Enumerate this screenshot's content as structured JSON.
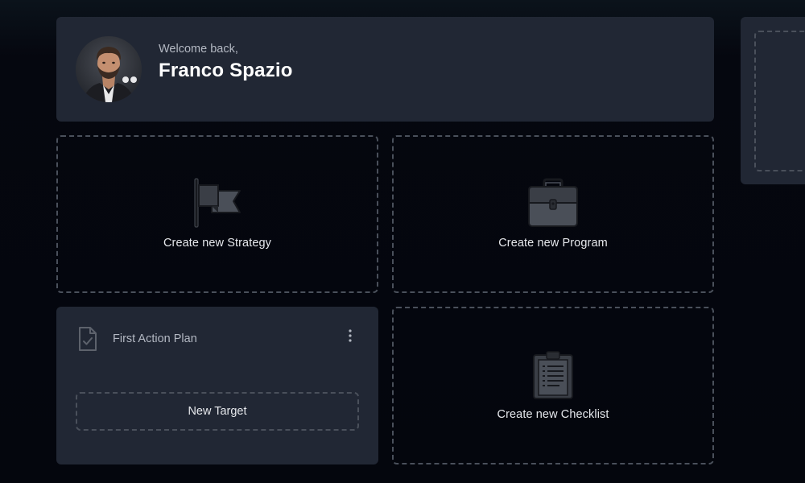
{
  "welcome": {
    "greeting": "Welcome back,",
    "user_name": "Franco Spazio"
  },
  "cards": {
    "strategy_label": "Create new Strategy",
    "program_label": "Create new Program",
    "checklist_label": "Create new Checklist"
  },
  "action_plan": {
    "title": "First Action Plan",
    "new_target_label": "New Target"
  },
  "icons": {
    "strategy": "flag-icon",
    "program": "briefcase-icon",
    "checklist": "clipboard-icon",
    "action_plan": "document-check-icon",
    "menu": "kebab-menu-icon"
  },
  "colors": {
    "background": "#04060d",
    "panel": "#212734",
    "dashed_border": "#4a505b",
    "text_primary": "#ffffff",
    "text_secondary": "#b3b8c2"
  }
}
